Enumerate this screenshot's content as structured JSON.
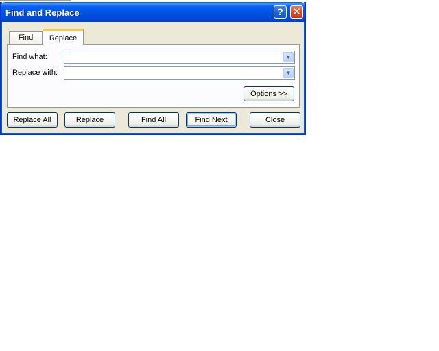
{
  "window": {
    "title": "Find and Replace",
    "help_glyph": "?",
    "close_glyph": "✕"
  },
  "tabs": [
    {
      "label": "Find",
      "selected": false
    },
    {
      "label": "Replace",
      "selected": true
    }
  ],
  "fields": {
    "find_what": {
      "label": "Find what:",
      "value": ""
    },
    "replace_with": {
      "label": "Replace with:",
      "value": ""
    }
  },
  "dropdown_glyph": "▼",
  "buttons": {
    "options": "Options >>",
    "replace_all": "Replace All",
    "replace": "Replace",
    "find_all": "Find All",
    "find_next": "Find Next",
    "close": "Close"
  },
  "colors": {
    "titlebar": "#0055e5",
    "dialog_bg": "#ece9d8",
    "tab_highlight": "#ffc83c"
  }
}
